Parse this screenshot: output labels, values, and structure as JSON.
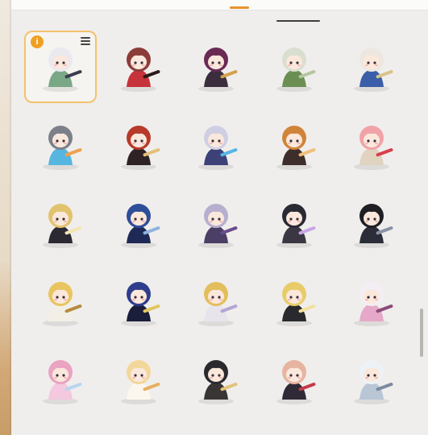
{
  "panel": {
    "selected_index": 0,
    "badge_label": "i"
  },
  "stickers": [
    {
      "name": "silver-hair-maid-chibi",
      "hair": "#e9e9ef",
      "outfit": "#7aa886",
      "accent": "#3c3c50"
    },
    {
      "name": "fox-ears-red-lying-chibi",
      "hair": "#8c3d3a",
      "outfit": "#c7333b",
      "accent": "#2a1b1b"
    },
    {
      "name": "purple-hair-lying-chibi",
      "hair": "#6a2a55",
      "outfit": "#3a2e3e",
      "accent": "#d4a24a"
    },
    {
      "name": "green-outfit-rabbit-chibi",
      "hair": "#d9dfd0",
      "outfit": "#6b8f52",
      "accent": "#b4c7a1"
    },
    {
      "name": "blue-hat-lying-chibi",
      "hair": "#ece8e0",
      "outfit": "#3b5ea8",
      "accent": "#d8c48a"
    },
    {
      "name": "gray-cat-swim-chibi",
      "hair": "#7b8089",
      "outfit": "#57b6df",
      "accent": "#f0a050"
    },
    {
      "name": "red-hair-sitting-chibi",
      "hair": "#b73a2a",
      "outfit": "#2f2224",
      "accent": "#e3c07a"
    },
    {
      "name": "silver-hair-gunner-chibi",
      "hair": "#cfcfe4",
      "outfit": "#3c4278",
      "accent": "#54b6e8"
    },
    {
      "name": "fox-tail-brown-chibi",
      "hair": "#d0843a",
      "outfit": "#3d2e2b",
      "accent": "#f1c07a"
    },
    {
      "name": "pink-hair-devil-chibi",
      "hair": "#f1a2a8",
      "outfit": "#e0d3c0",
      "accent": "#d8404c"
    },
    {
      "name": "blonde-nun-chibi",
      "hair": "#e2c36d",
      "outfit": "#2b2a33",
      "accent": "#f4e6b4"
    },
    {
      "name": "blue-hair-sniper-chibi",
      "hair": "#2f4e9a",
      "outfit": "#1e2a55",
      "accent": "#8fb3e0"
    },
    {
      "name": "lavender-hair-sitting-chibi",
      "hair": "#b6afcf",
      "outfit": "#4b3f66",
      "accent": "#6a4b8c"
    },
    {
      "name": "bunny-ears-dark-chibi",
      "hair": "#2a2a34",
      "outfit": "#3b3742",
      "accent": "#c9a6e6"
    },
    {
      "name": "black-hair-guard-chibi",
      "hair": "#1f1f24",
      "outfit": "#2b2e38",
      "accent": "#8a93a6"
    },
    {
      "name": "blonde-schoolgirl-chibi",
      "hair": "#e8c560",
      "outfit": "#f4efe6",
      "accent": "#b88a3e"
    },
    {
      "name": "witch-hat-blue-chibi",
      "hair": "#2e3e8c",
      "outfit": "#1b1e3a",
      "accent": "#e0c860"
    },
    {
      "name": "blonde-glasses-chibi",
      "hair": "#e2be5c",
      "outfit": "#e8e4ec",
      "accent": "#b3a6d6"
    },
    {
      "name": "black-bow-blonde-chibi",
      "hair": "#e8cc6a",
      "outfit": "#2a2a2e",
      "accent": "#f4e0a0"
    },
    {
      "name": "white-hair-staff-chibi",
      "hair": "#f3eef4",
      "outfit": "#e6a8c8",
      "accent": "#8c4b7a"
    },
    {
      "name": "pink-hair-flower-chibi",
      "hair": "#eba3c2",
      "outfit": "#f4c8de",
      "accent": "#b7d6f0"
    },
    {
      "name": "blonde-veil-bride-chibi",
      "hair": "#f2d79a",
      "outfit": "#fbf7ef",
      "accent": "#e6b060"
    },
    {
      "name": "black-veil-nun-chibi",
      "hair": "#2a2a2e",
      "outfit": "#3a3535",
      "accent": "#e3c37a"
    },
    {
      "name": "pink-hair-gun-chibi",
      "hair": "#e8b4a2",
      "outfit": "#2f2a36",
      "accent": "#c43a4b"
    },
    {
      "name": "white-hair-lying-chibi",
      "hair": "#edf2f6",
      "outfit": "#b8c6d6",
      "accent": "#7a8aa0"
    }
  ]
}
